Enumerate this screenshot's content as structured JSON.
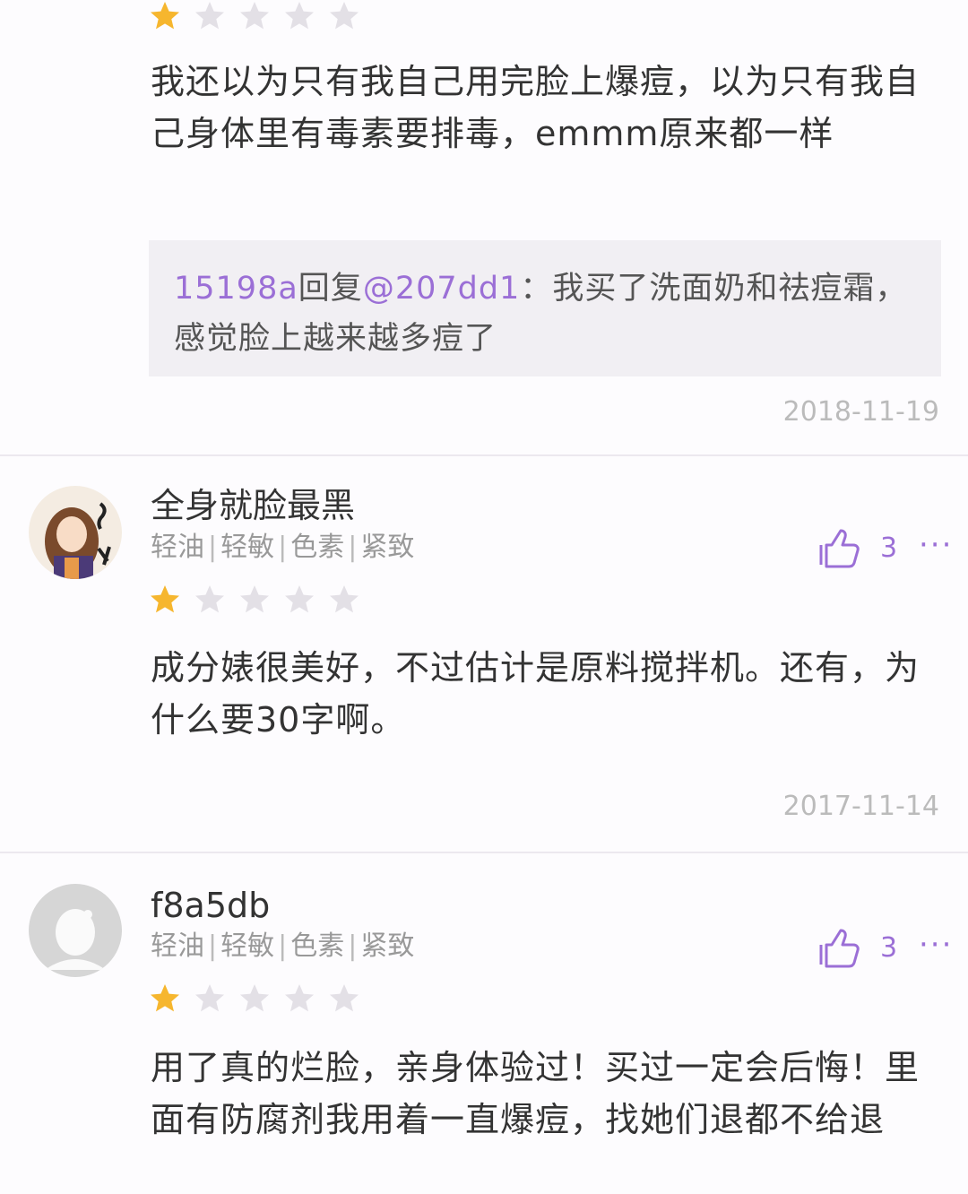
{
  "reviews": [
    {
      "stars": 1,
      "total_stars": 5,
      "text": "我还以为只有我自己用完脸上爆痘，以为只有我自己身体里有毒素要排毒，emmm原来都一样",
      "reply": {
        "author": "15198a",
        "verb": "回复",
        "mention": "@207dd1",
        "text": "：我买了洗面奶和祛痘霜，感觉脸上越来越多痘了"
      },
      "date": "2018-11-19"
    },
    {
      "username": "全身就脸最黑",
      "tags": [
        "轻油",
        "轻敏",
        "色素",
        "紧致"
      ],
      "likes": "3",
      "stars": 1,
      "total_stars": 5,
      "text": "成分婊很美好，不过估计是原料搅拌机。还有，为什么要30字啊。",
      "date": "2017-11-14",
      "more_label": "···"
    },
    {
      "username": "f8a5db",
      "tags": [
        "轻油",
        "轻敏",
        "色素",
        "紧致"
      ],
      "likes": "3",
      "stars": 1,
      "total_stars": 5,
      "text": "用了真的烂脸，亲身体验过！买过一定会后悔！里面有防腐剂我用着一直爆痘，找她们退都不给退",
      "more_label": "···"
    }
  ],
  "colors": {
    "accent": "#9b6fd6",
    "star_filled": "#f6b62e",
    "star_empty": "#e3e0e6",
    "reply_bg": "#f1eff3",
    "date": "#bbbbbb"
  },
  "icons": {
    "like": "thumbs-up-icon",
    "more": "more-dots-icon",
    "star": "star-icon"
  }
}
